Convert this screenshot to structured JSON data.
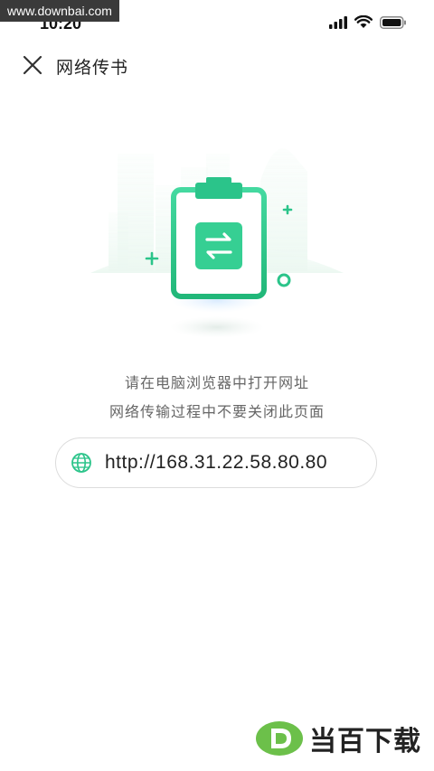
{
  "watermark": {
    "text": "www.downbai.com"
  },
  "status_bar": {
    "time": "10:20"
  },
  "nav": {
    "title": "网络传书"
  },
  "instructions": {
    "line1": "请在电脑浏览器中打开网址",
    "line2": "网络传输过程中不要关闭此页面"
  },
  "url": {
    "value": "http://168.31.22.58.80.80"
  },
  "brand": {
    "name": "当百下载",
    "logo_letter": "D"
  },
  "colors": {
    "accent": "#2bc48a",
    "accent_dark": "#1fa873",
    "text_secondary": "#666666"
  }
}
